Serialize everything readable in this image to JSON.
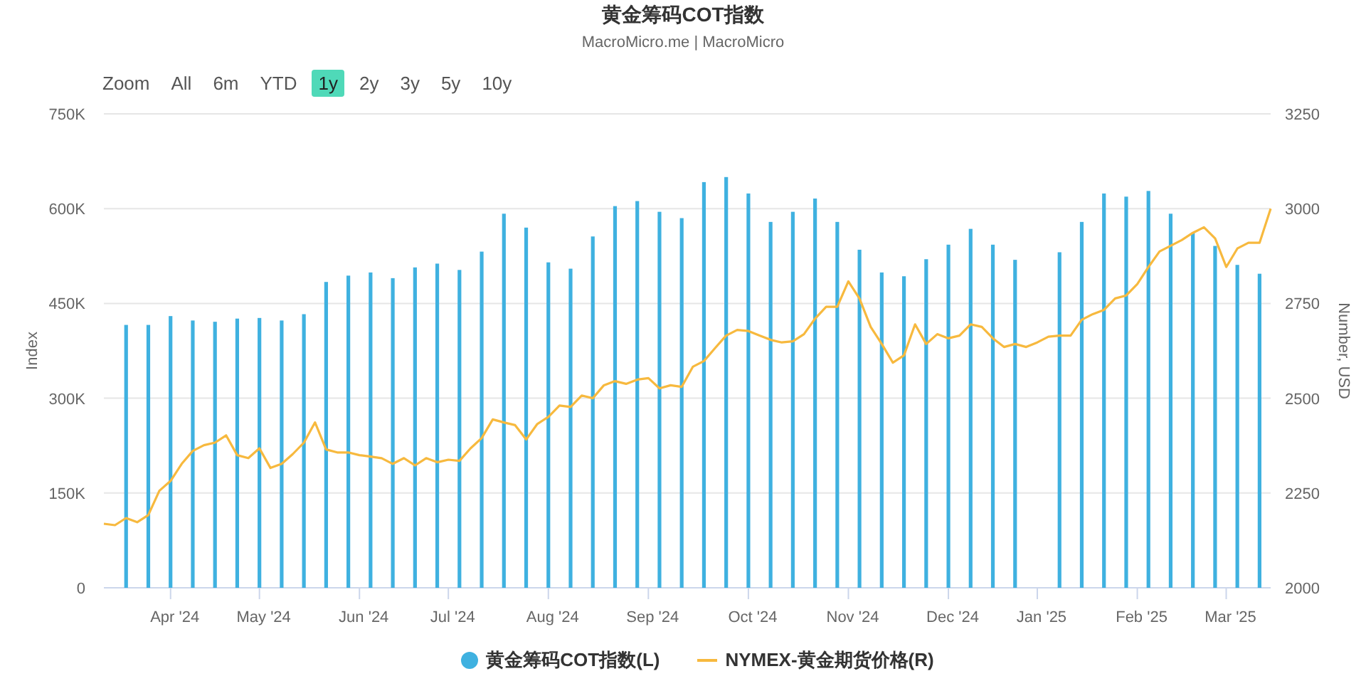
{
  "title": "黄金筹码COT指数",
  "subtitle": "MacroMicro.me | MacroMicro",
  "range_selector": {
    "label": "Zoom",
    "buttons": [
      {
        "label": "All",
        "selected": false
      },
      {
        "label": "6m",
        "selected": false
      },
      {
        "label": "YTD",
        "selected": false
      },
      {
        "label": "1y",
        "selected": true
      },
      {
        "label": "2y",
        "selected": false
      },
      {
        "label": "3y",
        "selected": false
      },
      {
        "label": "5y",
        "selected": false
      },
      {
        "label": "10y",
        "selected": false
      }
    ]
  },
  "chart": {
    "chart_data": {
      "type": "bar",
      "ylabel": "Index",
      "grid": true,
      "categories": [
        null,
        null,
        null,
        null,
        null,
        null,
        "Apr '24",
        null,
        null,
        null,
        null,
        null,
        null,
        null,
        "May '24",
        null,
        null,
        null,
        null,
        null,
        null,
        null,
        null,
        "Jun '24",
        null,
        null,
        null,
        null,
        null,
        null,
        null,
        "Jul '24",
        null,
        null,
        null,
        null,
        null,
        null,
        null,
        null,
        "Aug '24",
        null,
        null,
        null,
        null,
        null,
        null,
        null,
        null,
        "Sep '24",
        null,
        null,
        null,
        null,
        null,
        null,
        null,
        null,
        "Oct '24",
        null,
        null,
        null,
        null,
        null,
        null,
        null,
        null,
        "Nov '24",
        null,
        null,
        null,
        null,
        null,
        null,
        null,
        null,
        "Dec '24",
        null,
        null,
        null,
        null,
        null,
        null,
        null,
        "Jan '25",
        null,
        null,
        null,
        null,
        null,
        null,
        null,
        null,
        "Feb '25",
        null,
        null,
        null,
        null,
        null,
        null,
        null,
        "Mar '25",
        null,
        null,
        null,
        null
      ],
      "ylim": [
        0,
        750
      ],
      "yticks": [
        {
          "value": 0,
          "label": "0"
        },
        {
          "value": 150,
          "label": "150K"
        },
        {
          "value": 300,
          "label": "300K"
        },
        {
          "value": 450,
          "label": "450K"
        },
        {
          "value": 600,
          "label": "600K"
        },
        {
          "value": 750,
          "label": "750K"
        }
      ],
      "series": [
        {
          "name": "黄金筹码COT指数(L)",
          "color": "#3fb1e0",
          "values": [
            null,
            null,
            416,
            null,
            416,
            null,
            430,
            null,
            423,
            null,
            421,
            null,
            426,
            null,
            427,
            null,
            423,
            null,
            433,
            null,
            484,
            null,
            494,
            null,
            499,
            null,
            490,
            null,
            507,
            null,
            513,
            null,
            503,
            null,
            532,
            null,
            592,
            null,
            570,
            null,
            515,
            null,
            505,
            null,
            556,
            null,
            604,
            null,
            612,
            null,
            595,
            null,
            585,
            null,
            642,
            null,
            650,
            null,
            624,
            null,
            579,
            null,
            595,
            null,
            616,
            null,
            579,
            null,
            535,
            null,
            499,
            null,
            493,
            null,
            520,
            null,
            543,
            null,
            568,
            null,
            543,
            null,
            519,
            null,
            null,
            null,
            531,
            null,
            579,
            null,
            624,
            null,
            619,
            null,
            628,
            null,
            592,
            null,
            562,
            null,
            541,
            null,
            511,
            null,
            497,
            null
          ]
        }
      ]
    },
    "overlay": {
      "chart_data": {
        "type": "line",
        "ylabel": "Number, USD",
        "ylim": [
          2000,
          3250
        ],
        "yticks": [
          2000,
          2250,
          2500,
          2750,
          3000,
          3250
        ],
        "series": [
          {
            "name": "NYMEX-黄金期货价格(R)",
            "color": "#f7b93e",
            "values": [
              2169,
              2165,
              2184,
              2173,
              2192,
              2256,
              2282,
              2327,
              2361,
              2376,
              2383,
              2402,
              2350,
              2342,
              2368,
              2316,
              2327,
              2353,
              2383,
              2436,
              2365,
              2357,
              2357,
              2350,
              2346,
              2342,
              2327,
              2342,
              2323,
              2342,
              2331,
              2338,
              2335,
              2368,
              2395,
              2444,
              2436,
              2429,
              2391,
              2432,
              2451,
              2481,
              2477,
              2507,
              2500,
              2534,
              2545,
              2538,
              2549,
              2553,
              2526,
              2534,
              2530,
              2583,
              2598,
              2632,
              2665,
              2680,
              2677,
              2665,
              2654,
              2647,
              2650,
              2669,
              2710,
              2741,
              2741,
              2808,
              2763,
              2688,
              2643,
              2594,
              2613,
              2695,
              2643,
              2669,
              2658,
              2665,
              2695,
              2688,
              2658,
              2635,
              2643,
              2635,
              2647,
              2662,
              2665,
              2665,
              2707,
              2722,
              2733,
              2763,
              2771,
              2801,
              2846,
              2887,
              2902,
              2917,
              2936,
              2951,
              2921,
              2846,
              2895,
              2910,
              2910,
              3000
            ]
          }
        ]
      }
    }
  }
}
